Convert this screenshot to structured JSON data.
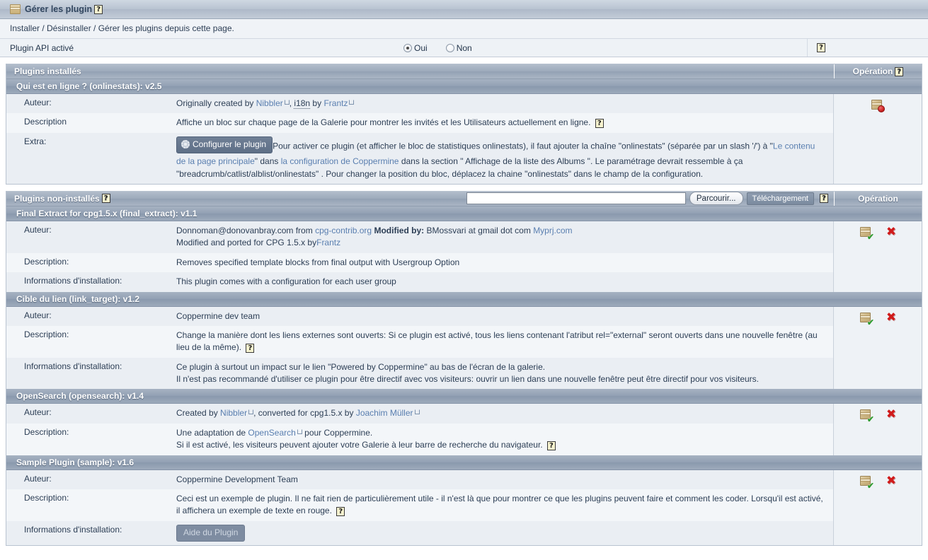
{
  "window": {
    "title": "Gérer les plugin",
    "icon": "box-icon",
    "help": "?",
    "subtitle": "Installer / Désinstaller / Gérer les plugins depuis cette page."
  },
  "api_row": {
    "label": "Plugin API activé",
    "options": [
      {
        "label": "Oui",
        "selected": true
      },
      {
        "label": "Non",
        "selected": false
      }
    ],
    "help": "?"
  },
  "installed_panel": {
    "title": "Plugins installés",
    "operation_header": "Opération",
    "operation_help": "?",
    "plugins": [
      {
        "header": "Qui est en ligne ? (onlinestats): v2.5",
        "op_icons": [
          "uninstall-icon"
        ],
        "rows": [
          {
            "key": "Auteur:",
            "segments": [
              {
                "t": "Originally created by ",
                "type": "text"
              },
              {
                "t": "Nibbler",
                "type": "link-ext"
              },
              {
                "t": ", ",
                "type": "text"
              },
              {
                "t": "i18n",
                "type": "dotted"
              },
              {
                "t": " by ",
                "type": "text"
              },
              {
                "t": "Frantz",
                "type": "link-ext"
              }
            ]
          },
          {
            "key": "Description",
            "segments": [
              {
                "t": "Affiche un bloc sur chaque page de la Galerie pour montrer les invités et les Utilisateurs actuellement en ligne. ",
                "type": "text"
              },
              {
                "t": "?",
                "type": "help"
              }
            ]
          },
          {
            "key": "Extra:",
            "button": {
              "label": "Configurer le plugin",
              "icon": "gear-icon"
            },
            "segments": [
              {
                "t": "Pour activer ce plugin (et afficher le bloc de statistiques onlinestats), il faut ajouter la chaîne \"onlinestats\" (séparée par un slash '/') à \"",
                "type": "text"
              },
              {
                "t": "Le contenu de la page principale",
                "type": "link"
              },
              {
                "t": "\" dans ",
                "type": "text"
              },
              {
                "t": "la configuration de Coppermine",
                "type": "link"
              },
              {
                "t": " dans la section \" Affichage de la liste des Albums \". Le paramétrage devrait ressemble à ça \"breadcrumb/catlist/alblist/onlinestats\" . Pour changer la position du bloc, déplacez la chaine \"onlinestats\" dans le champ de la configuration.",
                "type": "text"
              }
            ]
          }
        ]
      }
    ]
  },
  "noninstalled_panel": {
    "title": "Plugins non-installés",
    "title_help": "?",
    "operation_header": "Opération",
    "upload": {
      "file_value": "",
      "file_placeholder": "",
      "browse_label": "Parcourir...",
      "upload_label": "Téléchargement",
      "help": "?"
    },
    "plugins": [
      {
        "header": "Final Extract for cpg1.5.x (final_extract): v1.1",
        "op_icons": [
          "install-icon",
          "delete-icon"
        ],
        "rows": [
          {
            "key": "Auteur:",
            "segments": [
              {
                "t": "Donnoman@donovanbray.com from ",
                "type": "text"
              },
              {
                "t": "cpg-contrib.org",
                "type": "link"
              },
              {
                "t": " ",
                "type": "text"
              },
              {
                "t": "Modified by:",
                "type": "bold"
              },
              {
                "t": " BMossvari at gmail dot com ",
                "type": "text"
              },
              {
                "t": "Myprj.com",
                "type": "link"
              },
              {
                "t": "\n",
                "type": "br"
              },
              {
                "t": "Modified and ported for CPG 1.5.x by",
                "type": "text"
              },
              {
                "t": "Frantz",
                "type": "link"
              }
            ]
          },
          {
            "key": "Description:",
            "segments": [
              {
                "t": "Removes specified template blocks from final output with Usergroup Option",
                "type": "text"
              }
            ]
          },
          {
            "key": "Informations d'installation:",
            "segments": [
              {
                "t": "This plugin comes with a configuration for each user group",
                "type": "text"
              }
            ]
          }
        ]
      },
      {
        "header": "Cible du lien (link_target): v1.2",
        "op_icons": [
          "install-icon",
          "delete-icon"
        ],
        "rows": [
          {
            "key": "Auteur:",
            "segments": [
              {
                "t": "Coppermine dev team",
                "type": "text"
              }
            ]
          },
          {
            "key": "Description:",
            "segments": [
              {
                "t": "Change la manière dont les liens externes sont ouverts: Si ce plugin est activé, tous les liens contenant l'atribut rel=\"external\" seront ouverts dans une nouvelle fenêtre (au lieu de la même). ",
                "type": "text"
              },
              {
                "t": "?",
                "type": "help"
              }
            ]
          },
          {
            "key": "Informations d'installation:",
            "segments": [
              {
                "t": "Ce plugin à surtout un impact sur le lien \"Powered by Coppermine\" au bas de l'écran de la galerie.",
                "type": "text"
              },
              {
                "t": "\n",
                "type": "br"
              },
              {
                "t": "Il n'est pas recommandé d'utiliser ce plugin pour être directif avec vos visiteurs: ouvrir un lien dans une nouvelle fenêtre peut être directif pour vos visiteurs.",
                "type": "text"
              }
            ]
          }
        ]
      },
      {
        "header": "OpenSearch (opensearch): v1.4",
        "op_icons": [
          "install-icon",
          "delete-icon"
        ],
        "rows": [
          {
            "key": "Auteur:",
            "segments": [
              {
                "t": "Created by ",
                "type": "text"
              },
              {
                "t": "Nibbler",
                "type": "link-ext"
              },
              {
                "t": ", converted for cpg1.5.x by ",
                "type": "text"
              },
              {
                "t": "Joachim Müller",
                "type": "link-ext"
              }
            ]
          },
          {
            "key": "Description:",
            "segments": [
              {
                "t": "Une adaptation de ",
                "type": "text"
              },
              {
                "t": "OpenSearch",
                "type": "link-ext"
              },
              {
                "t": " pour Coppermine.",
                "type": "text"
              },
              {
                "t": "\n",
                "type": "br"
              },
              {
                "t": "Si il est activé, les visiteurs peuvent ajouter votre Galerie à leur barre de recherche du navigateur. ",
                "type": "text"
              },
              {
                "t": "?",
                "type": "help"
              }
            ]
          }
        ]
      },
      {
        "header": "Sample Plugin (sample): v1.6",
        "op_icons": [
          "install-icon",
          "delete-icon"
        ],
        "rows": [
          {
            "key": "Auteur:",
            "segments": [
              {
                "t": "Coppermine Development Team",
                "type": "text"
              }
            ]
          },
          {
            "key": "Description:",
            "segments": [
              {
                "t": "Ceci est un exemple de plugin. Il ne fait rien de particulièrement utile - il n'est là que pour montrer ce que les plugins peuvent faire et comment les coder. Lorsqu'il est activé, il affichera un exemple de texte en rouge. ",
                "type": "text"
              },
              {
                "t": "?",
                "type": "help"
              }
            ]
          },
          {
            "key": "Informations d'installation:",
            "helpbutton": "Aide du Plugin",
            "segments": []
          }
        ]
      }
    ]
  },
  "colors": {
    "header_blue": "#93a1b4",
    "row_light": "#f3f6f9",
    "row_dark": "#eaeef3",
    "link": "#5a7fb0",
    "danger": "#d01b1b"
  }
}
